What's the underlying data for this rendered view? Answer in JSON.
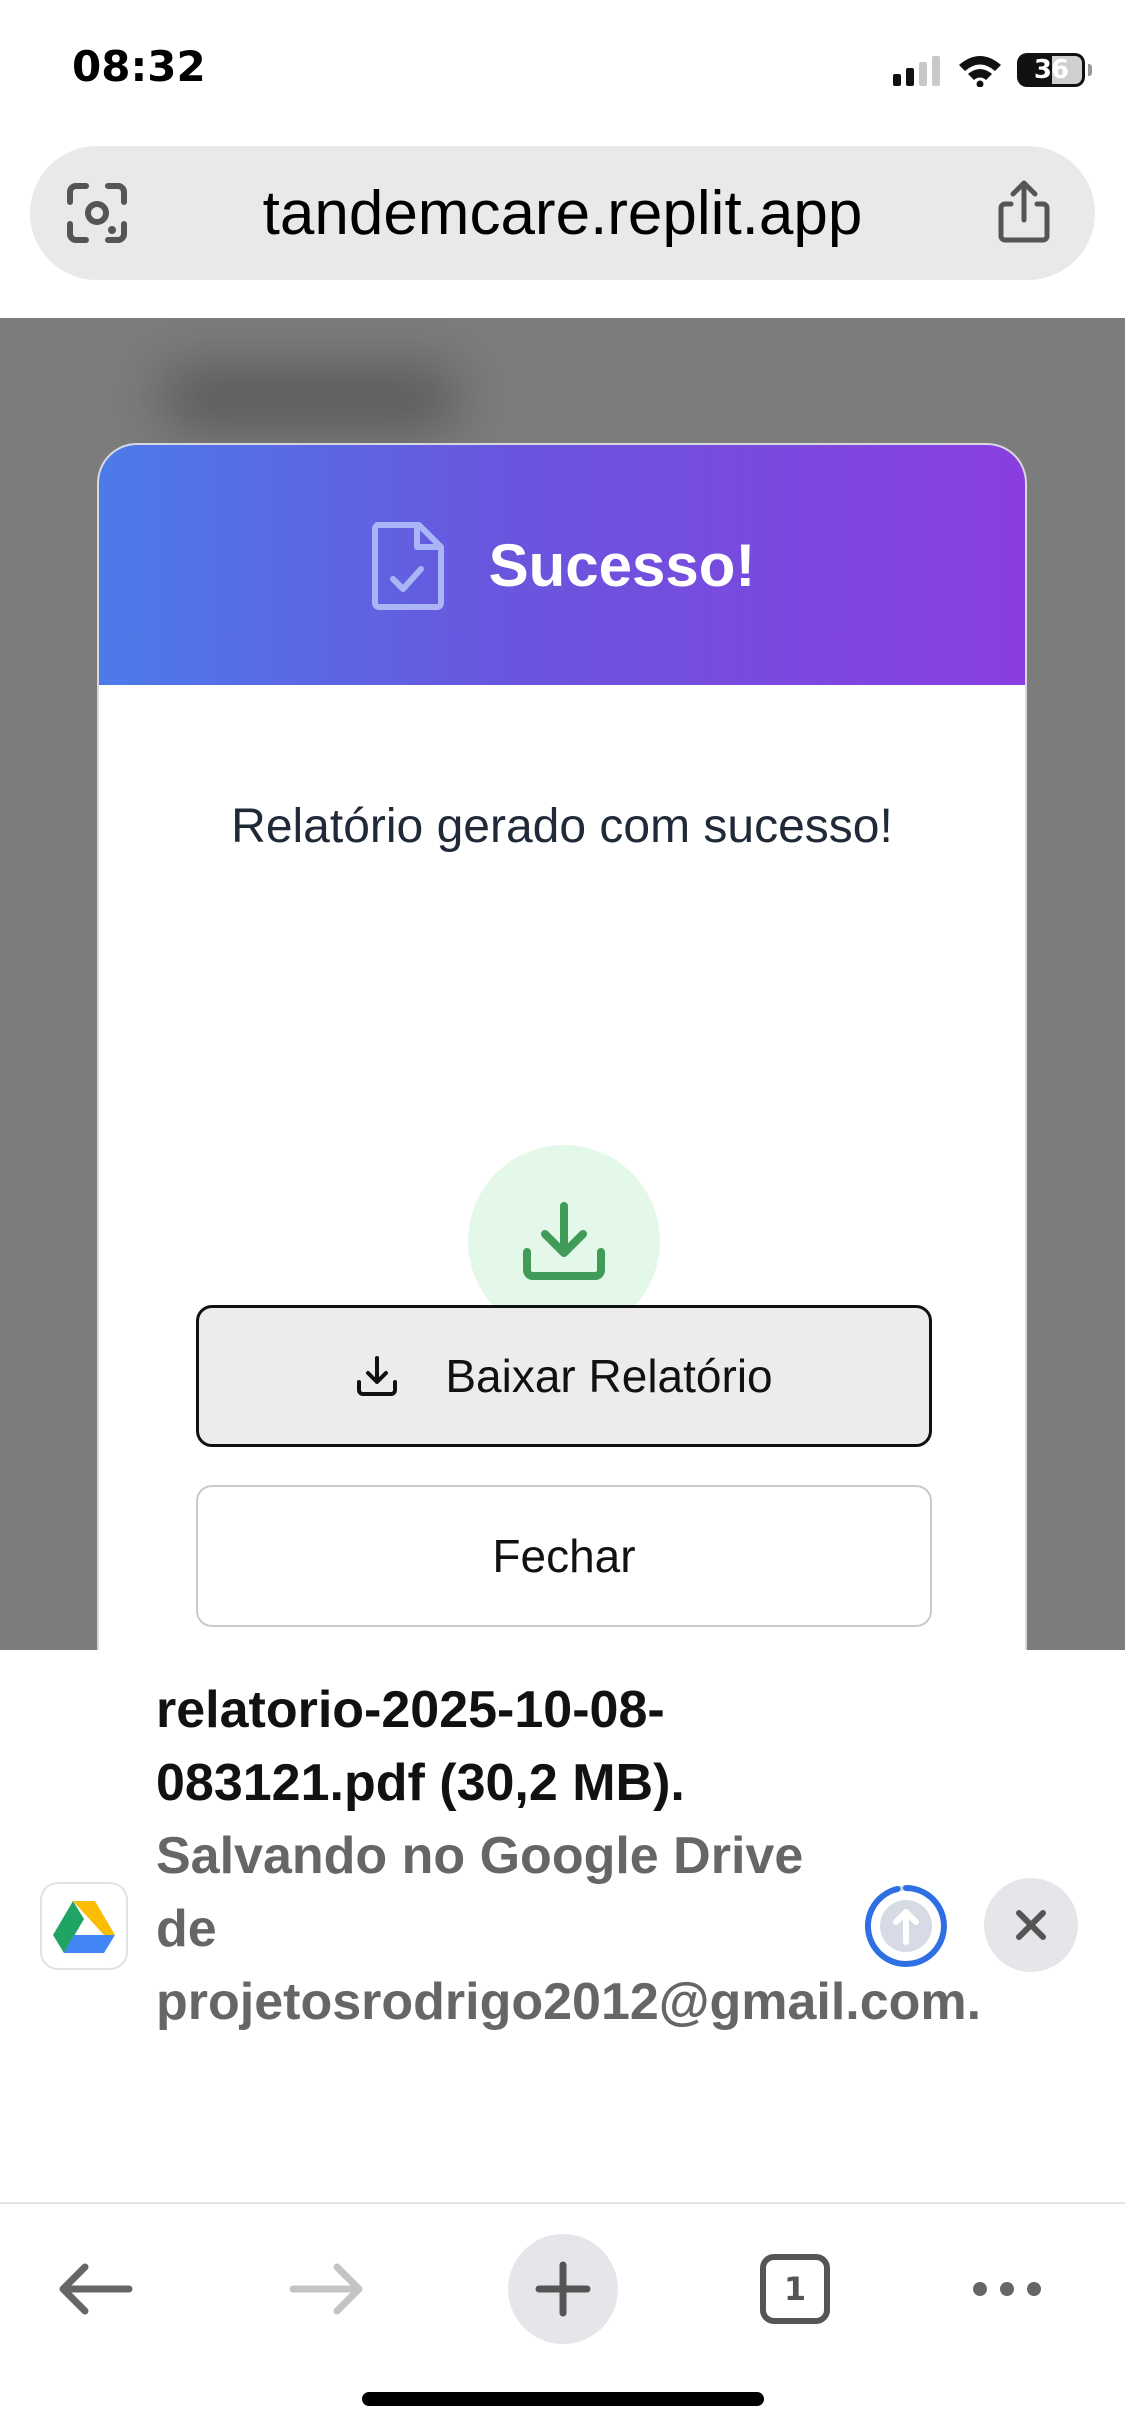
{
  "status_bar": {
    "time": "08:32",
    "battery": "36",
    "icons": [
      "signal-icon",
      "wifi-icon",
      "battery-icon"
    ]
  },
  "address_bar": {
    "url": "tandemcare.replit.app",
    "left_icon": "lens-icon",
    "right_icon": "share-icon"
  },
  "modal": {
    "title": "Sucesso!",
    "header_icon": "document-check-icon",
    "message": "Relatório gerado com sucesso!",
    "center_icon": "download-icon",
    "primary_button": {
      "label": "Baixar Relatório",
      "icon": "download-icon"
    },
    "secondary_button": {
      "label": "Fechar"
    },
    "colors": {
      "gradient_start": "#4c7be8",
      "gradient_end": "#8a3ee0",
      "success_bg": "#e3f8e9",
      "success_icon": "#3f9b57"
    }
  },
  "download_notification": {
    "filename": "relatorio-2025-10-08-083121.pdf (30,2 MB).",
    "status": "Salvando no Google Drive de projetosrodrigo2012@gmail.com.",
    "app_icon": "google-drive-icon",
    "progress_icon": "upload-progress-icon",
    "close_icon": "close-icon"
  },
  "toolbar": {
    "back_icon": "back-arrow-icon",
    "forward_icon": "forward-arrow-icon",
    "new_tab_icon": "plus-icon",
    "tab_count": "1",
    "more_icon": "more-icon"
  }
}
